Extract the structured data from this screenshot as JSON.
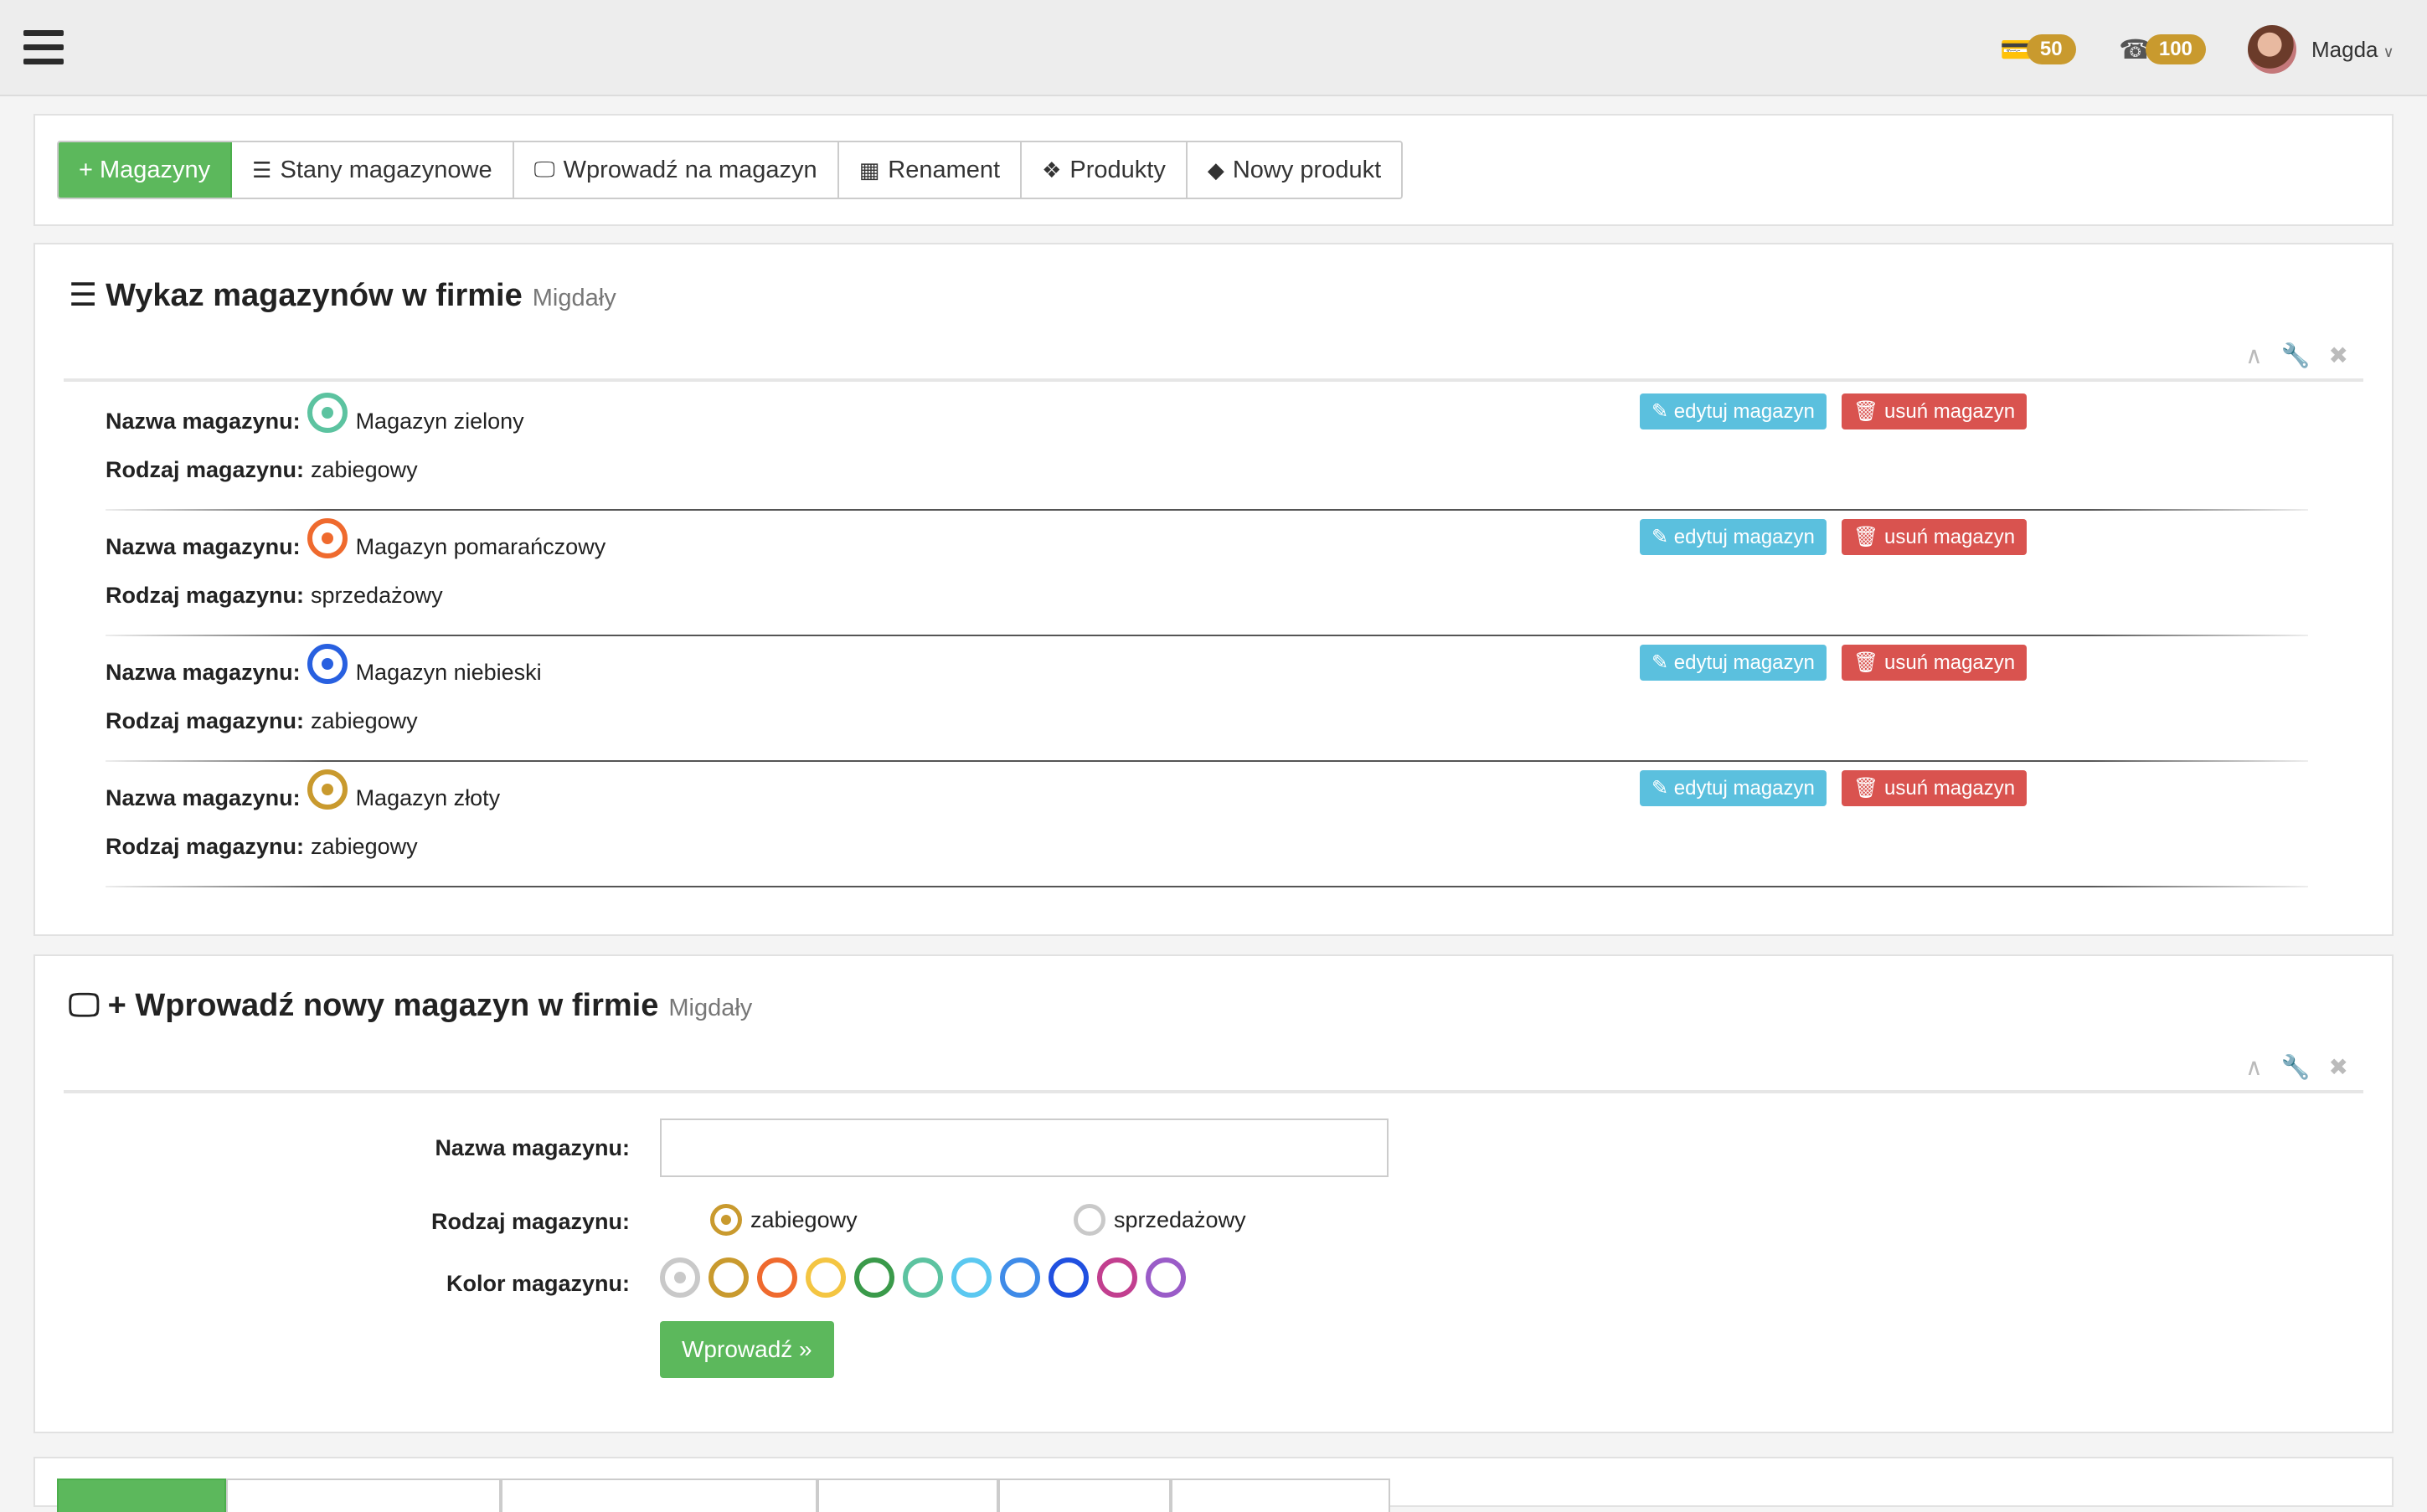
{
  "header": {
    "menu_icon": "hamburger-icon",
    "notifications": [
      {
        "icon": "credit-card-icon",
        "count": "50"
      },
      {
        "icon": "phone-icon",
        "count": "100"
      }
    ],
    "user": {
      "name": "Magda"
    }
  },
  "tabs": [
    {
      "label": "+ Magazyny",
      "icon": "",
      "active": true
    },
    {
      "label": "Stany magazynowe",
      "icon": "database-icon"
    },
    {
      "label": "Wprowadź na magazyn",
      "icon": "monitor-icon"
    },
    {
      "label": "Renament",
      "icon": "table-icon"
    },
    {
      "label": "Produkty",
      "icon": "cubes-icon"
    },
    {
      "label": "Nowy produkt",
      "icon": "cube-icon"
    }
  ],
  "list": {
    "title": "Wykaz magazynów w firmie",
    "company": "Migdały",
    "name_label": "Nazwa magazynu:",
    "type_label": "Rodzaj magazynu:",
    "edit_label": "edytuj magazyn",
    "delete_label": "usuń magazyn",
    "items": [
      {
        "name": "Magazyn zielony",
        "type": "zabiegowy",
        "color": "#5cc3a0"
      },
      {
        "name": "Magazyn pomarańczowy",
        "type": "sprzedażowy",
        "color": "#ef6a2e"
      },
      {
        "name": "Magazyn niebieski",
        "type": "zabiegowy",
        "color": "#2860e0"
      },
      {
        "name": "Magazyn złoty",
        "type": "zabiegowy",
        "color": "#c99a2e"
      }
    ]
  },
  "form": {
    "title": "+ Wprowadź nowy magazyn w firmie",
    "company": "Migdały",
    "name_label": "Nazwa magazynu:",
    "name_value": "",
    "type_label": "Rodzaj magazynu:",
    "type_options": [
      {
        "label": "zabiegowy",
        "selected": true
      },
      {
        "label": "sprzedażowy",
        "selected": false
      }
    ],
    "color_label": "Kolor magazynu:",
    "colors": [
      "#c9c9c9",
      "#c99a2e",
      "#ef6a2e",
      "#f4c542",
      "#3a9a4a",
      "#5cc3a0",
      "#5bc8f0",
      "#3f8be8",
      "#2050e0",
      "#c23f8f",
      "#9a5cc8"
    ],
    "submit_label": "Wprowadź »"
  }
}
